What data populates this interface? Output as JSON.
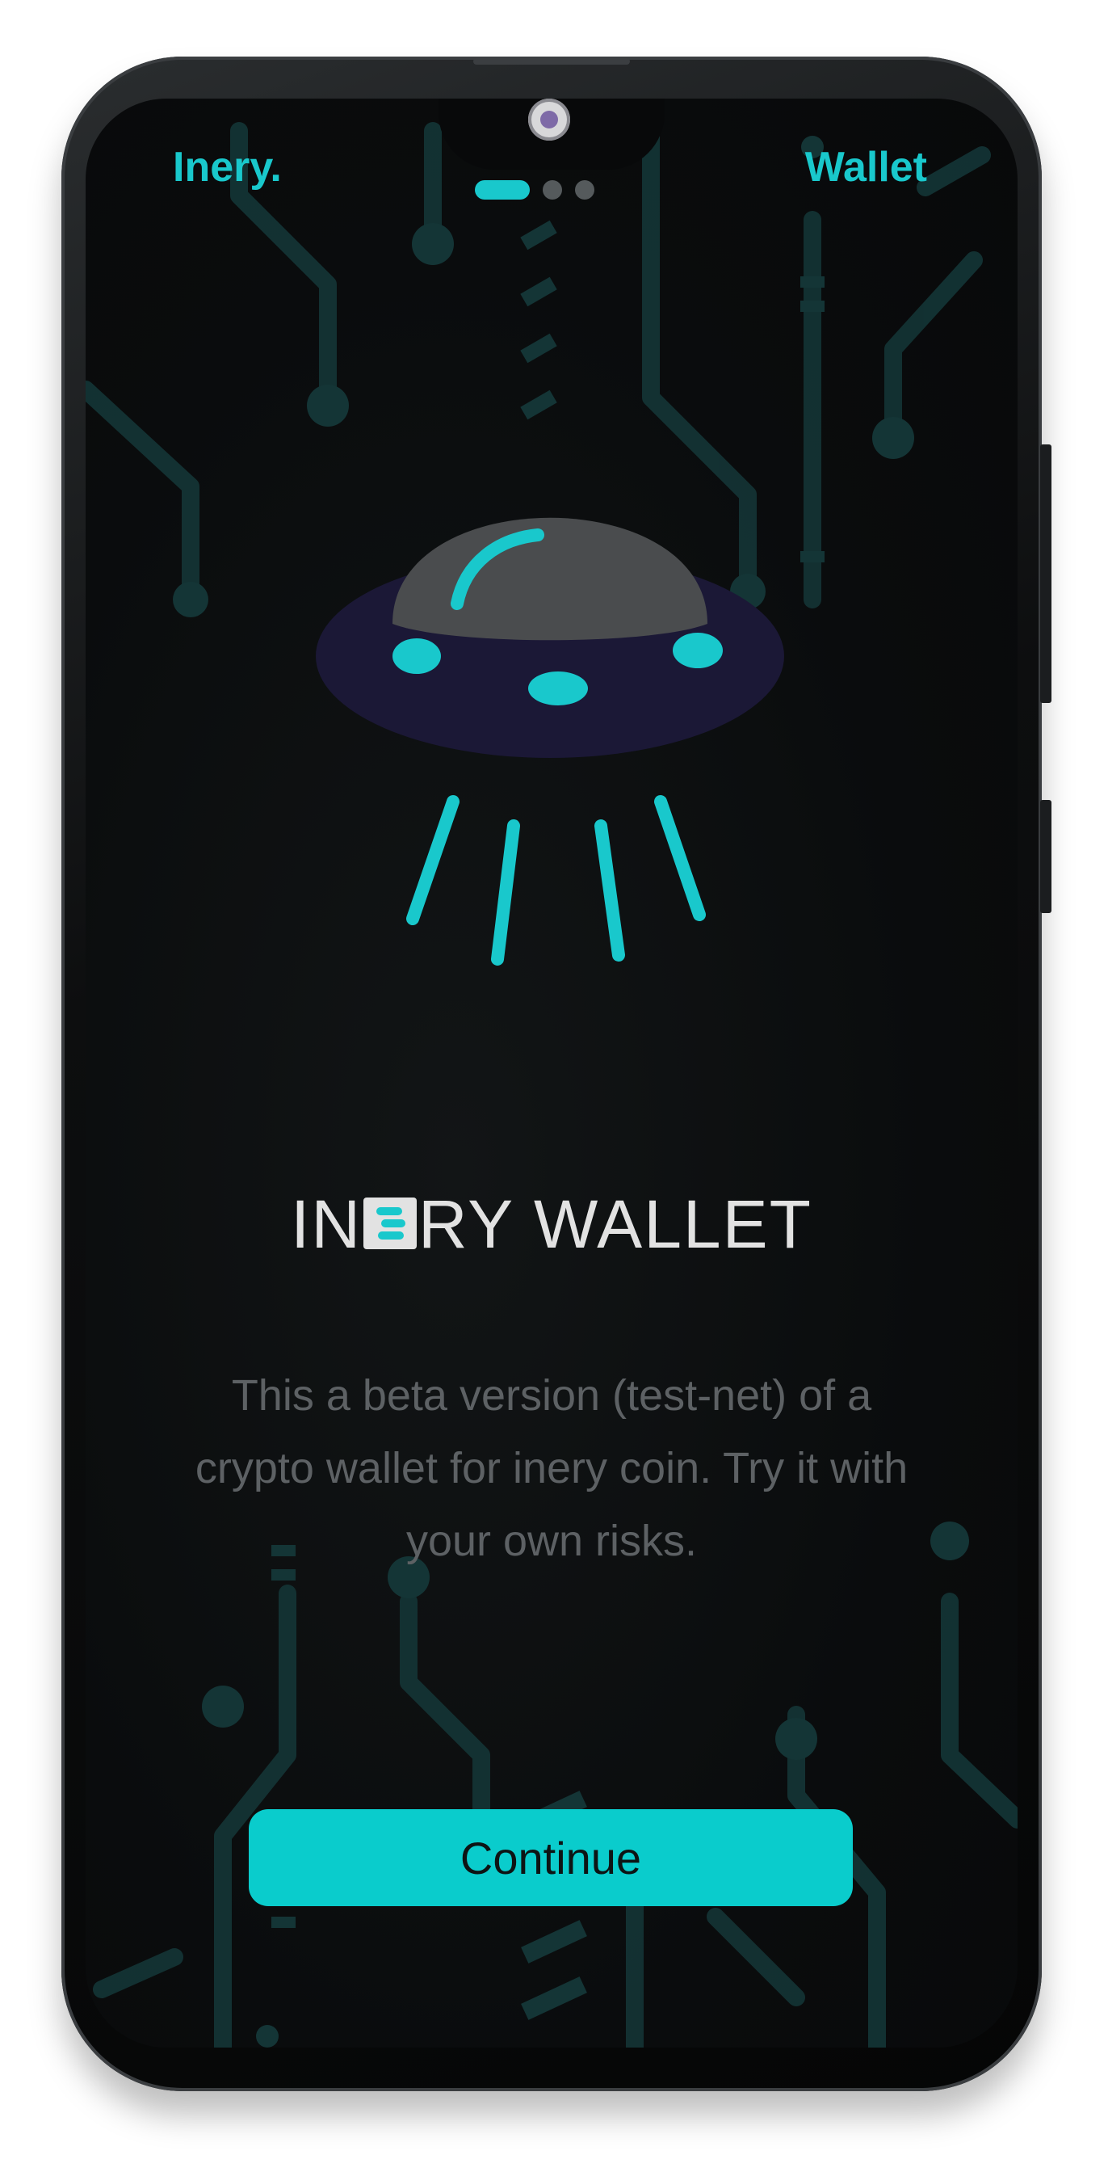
{
  "header": {
    "brand_left": "Inery.",
    "brand_right": "Wallet"
  },
  "pager": {
    "total": 3,
    "active_index": 0
  },
  "hero": {
    "icon": "ufo-illustration-icon"
  },
  "title": {
    "before_logo": "IN",
    "after_logo": "RY WALLET",
    "logo_icon": "inery-e-logo-icon"
  },
  "description": "This a beta version (test-net) of a crypto wallet for inery coin. Try it with your own risks.",
  "actions": {
    "continue_label": "Continue"
  },
  "colors": {
    "accent": "#19c8cc",
    "button": "#0acccc",
    "background": "#0a0c0d",
    "title_text": "#e2e2e2",
    "body_text": "#5d6164",
    "circuit": "#143536",
    "ufo_dome": "#4a4c4e",
    "ufo_saucer": "#1b1836"
  }
}
